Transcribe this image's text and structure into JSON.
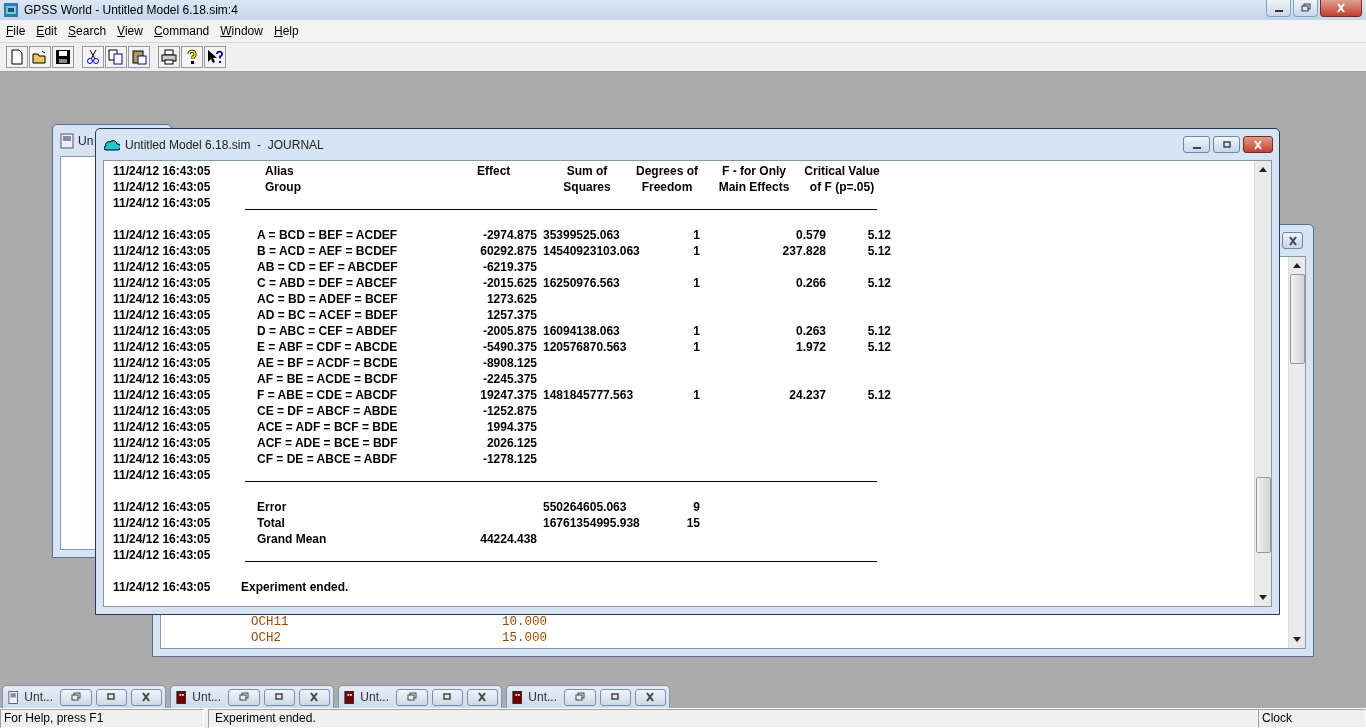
{
  "window": {
    "title": "GPSS World - Untitled Model 6.18.sim:4"
  },
  "menu": [
    {
      "label": "File"
    },
    {
      "label": "Edit"
    },
    {
      "label": "Search"
    },
    {
      "label": "View"
    },
    {
      "label": "Command"
    },
    {
      "label": "Window"
    },
    {
      "label": "Help"
    }
  ],
  "back_window_left": {
    "title": "Un"
  },
  "back_window_right": {
    "lines": [
      {
        "name": "OCH11",
        "value": "10.000"
      },
      {
        "name": "OCH2",
        "value": "15.000"
      }
    ]
  },
  "journal": {
    "title": "Untitled Model 6.18.sim  -  JOURNAL",
    "rows": [
      {
        "kind": "header",
        "time": "11/24/12 16:43:05",
        "alias": "Alias",
        "effect": "Effect",
        "ss": "Sum of",
        "df": "Degrees of",
        "f": "F - for Only",
        "crit": "Critical Value"
      },
      {
        "kind": "header",
        "time": "11/24/12 16:43:05",
        "alias": "Group",
        "ss": "Squares",
        "df": "Freedom",
        "f": "Main Effects",
        "crit": "of F (p=.05)"
      },
      {
        "kind": "rule",
        "time": "11/24/12 16:43:05"
      },
      {
        "kind": "gap"
      },
      {
        "kind": "data",
        "time": "11/24/12 16:43:05",
        "alias": "A = BCD = BEF = ACDEF",
        "effect": "-2974.875",
        "ss": "35399525.063",
        "df": "1",
        "f": "0.579",
        "crit": "5.12"
      },
      {
        "kind": "data",
        "time": "11/24/12 16:43:05",
        "alias": "B = ACD = AEF = BCDEF",
        "effect": "60292.875",
        "ss": "14540923103.063",
        "df": "1",
        "f": "237.828",
        "crit": "5.12"
      },
      {
        "kind": "data",
        "time": "11/24/12 16:43:05",
        "alias": "AB = CD = EF = ABCDEF",
        "effect": "-6219.375"
      },
      {
        "kind": "data",
        "time": "11/24/12 16:43:05",
        "alias": "C = ABD = DEF = ABCEF",
        "effect": "-2015.625",
        "ss": "16250976.563",
        "df": "1",
        "f": "0.266",
        "crit": "5.12"
      },
      {
        "kind": "data",
        "time": "11/24/12 16:43:05",
        "alias": "AC = BD = ADEF = BCEF",
        "effect": "1273.625"
      },
      {
        "kind": "data",
        "time": "11/24/12 16:43:05",
        "alias": "AD = BC = ACEF = BDEF",
        "effect": "1257.375"
      },
      {
        "kind": "data",
        "time": "11/24/12 16:43:05",
        "alias": "D = ABC = CEF = ABDEF",
        "effect": "-2005.875",
        "ss": "16094138.063",
        "df": "1",
        "f": "0.263",
        "crit": "5.12"
      },
      {
        "kind": "data",
        "time": "11/24/12 16:43:05",
        "alias": "E = ABF = CDF = ABCDE",
        "effect": "-5490.375",
        "ss": "120576870.563",
        "df": "1",
        "f": "1.972",
        "crit": "5.12"
      },
      {
        "kind": "data",
        "time": "11/24/12 16:43:05",
        "alias": "AE = BF = ACDF = BCDE",
        "effect": "-8908.125"
      },
      {
        "kind": "data",
        "time": "11/24/12 16:43:05",
        "alias": "AF = BE = ACDE = BCDF",
        "effect": "-2245.375"
      },
      {
        "kind": "data",
        "time": "11/24/12 16:43:05",
        "alias": "F = ABE = CDE = ABCDF",
        "effect": "19247.375",
        "ss": "1481845777.563",
        "df": "1",
        "f": "24.237",
        "crit": "5.12"
      },
      {
        "kind": "data",
        "time": "11/24/12 16:43:05",
        "alias": "CE = DF = ABCF = ABDE",
        "effect": "-1252.875"
      },
      {
        "kind": "data",
        "time": "11/24/12 16:43:05",
        "alias": "ACE = ADF = BCF = BDE",
        "effect": "1994.375"
      },
      {
        "kind": "data",
        "time": "11/24/12 16:43:05",
        "alias": "ACF = ADE = BCE = BDF",
        "effect": "2026.125"
      },
      {
        "kind": "data",
        "time": "11/24/12 16:43:05",
        "alias": "CF = DE = ABCE = ABDF",
        "effect": "-1278.125"
      },
      {
        "kind": "rule",
        "time": "11/24/12 16:43:05"
      },
      {
        "kind": "gap"
      },
      {
        "kind": "data",
        "time": "11/24/12 16:43:05",
        "alias": "Error",
        "ss": "550264605.063",
        "df": "9"
      },
      {
        "kind": "data",
        "time": "11/24/12 16:43:05",
        "alias": "Total",
        "ss": "16761354995.938",
        "df": "15"
      },
      {
        "kind": "data",
        "time": "11/24/12 16:43:05",
        "alias": "Grand Mean",
        "effect": "44224.438"
      },
      {
        "kind": "rule",
        "time": "11/24/12 16:43:05"
      },
      {
        "kind": "gap"
      },
      {
        "kind": "message",
        "time": "11/24/12 16:43:05",
        "text": "Experiment ended."
      }
    ]
  },
  "minimized_windows": [
    {
      "title": "Unt...",
      "kind": "model"
    },
    {
      "title": "Unt...",
      "kind": "report"
    },
    {
      "title": "Unt...",
      "kind": "report"
    },
    {
      "title": "Unt...",
      "kind": "report"
    }
  ],
  "status_bar": [
    "For Help, press F1",
    "Experiment ended.",
    "Clock"
  ]
}
